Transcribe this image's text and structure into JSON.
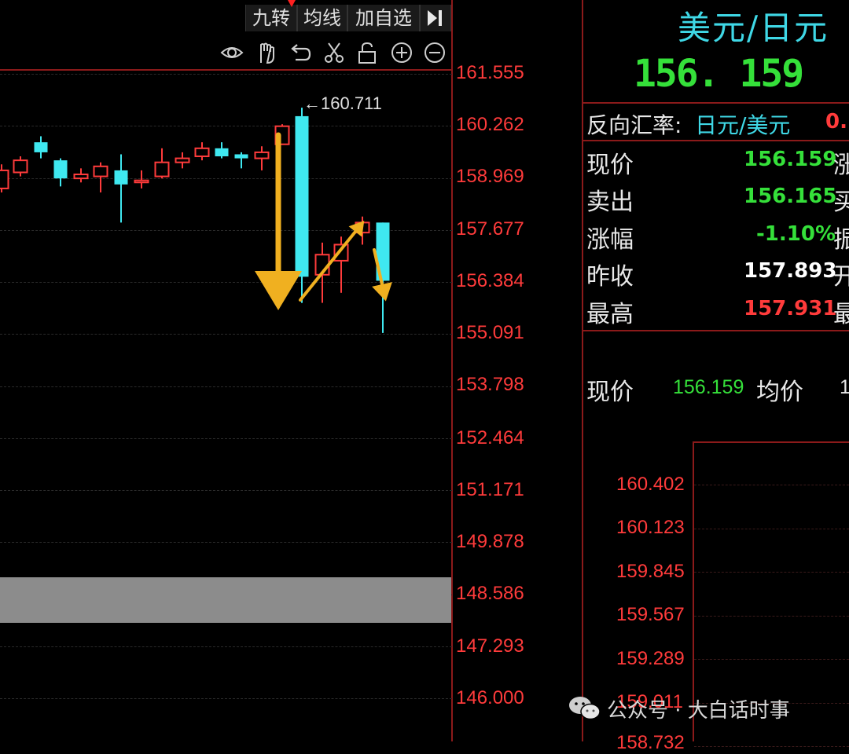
{
  "toolbar": {
    "buttons": [
      "九转",
      "均线",
      "加自选"
    ],
    "collapse_icon": "collapse-right-icon",
    "tools": [
      "eye-icon",
      "hand-icon",
      "undo-icon",
      "scissors-icon",
      "lock-icon",
      "zoom-in-icon",
      "zoom-out-icon"
    ]
  },
  "chart_data": {
    "type": "candlestick",
    "y_axis_labels": [
      "161.555",
      "160.262",
      "158.969",
      "157.677",
      "156.384",
      "155.091",
      "153.798",
      "152.464",
      "151.171",
      "149.878",
      "148.586",
      "147.293",
      "146.000"
    ],
    "ylim": [
      146.0,
      161.555
    ],
    "high_annotation": "160.711",
    "candles": [
      {
        "open": 158.7,
        "close": 159.15,
        "high": 159.3,
        "low": 158.6,
        "dir": "up"
      },
      {
        "open": 159.1,
        "close": 159.4,
        "high": 159.5,
        "low": 159.0,
        "dir": "up"
      },
      {
        "open": 159.6,
        "close": 159.85,
        "high": 160.0,
        "low": 159.45,
        "dir": "down"
      },
      {
        "open": 159.4,
        "close": 158.95,
        "high": 159.45,
        "low": 158.75,
        "dir": "down"
      },
      {
        "open": 158.95,
        "close": 159.05,
        "high": 159.2,
        "low": 158.85,
        "dir": "up"
      },
      {
        "open": 159.0,
        "close": 159.25,
        "high": 159.35,
        "low": 158.6,
        "dir": "up"
      },
      {
        "open": 159.15,
        "close": 158.8,
        "high": 159.55,
        "low": 157.85,
        "dir": "down"
      },
      {
        "open": 158.85,
        "close": 158.9,
        "high": 159.15,
        "low": 158.7,
        "dir": "up"
      },
      {
        "open": 159.0,
        "close": 159.35,
        "high": 159.7,
        "low": 158.95,
        "dir": "up"
      },
      {
        "open": 159.35,
        "close": 159.45,
        "high": 159.6,
        "low": 159.2,
        "dir": "up"
      },
      {
        "open": 159.5,
        "close": 159.7,
        "high": 159.85,
        "low": 159.4,
        "dir": "up"
      },
      {
        "open": 159.7,
        "close": 159.5,
        "high": 159.85,
        "low": 159.45,
        "dir": "down"
      },
      {
        "open": 159.55,
        "close": 159.45,
        "high": 159.6,
        "low": 159.2,
        "dir": "down"
      },
      {
        "open": 159.45,
        "close": 159.6,
        "high": 159.75,
        "low": 159.15,
        "dir": "up"
      },
      {
        "open": 159.8,
        "close": 160.25,
        "high": 160.3,
        "low": 159.8,
        "dir": "up"
      },
      {
        "open": 160.5,
        "close": 156.5,
        "high": 160.711,
        "low": 155.85,
        "dir": "down"
      },
      {
        "open": 156.55,
        "close": 157.05,
        "high": 157.35,
        "low": 155.85,
        "dir": "up"
      },
      {
        "open": 156.9,
        "close": 157.3,
        "high": 157.5,
        "low": 156.1,
        "dir": "up"
      },
      {
        "open": 157.6,
        "close": 157.85,
        "high": 158.0,
        "low": 157.3,
        "dir": "up"
      },
      {
        "open": 157.85,
        "close": 156.4,
        "high": 157.85,
        "low": 155.1,
        "dir": "down"
      }
    ],
    "colors": {
      "up": "#ff3b3b",
      "down": "#3fe8f0",
      "arrow": "#f0b020"
    }
  },
  "panel": {
    "title": "美元/日元",
    "price": "156. 159",
    "reverse_label": "反向汇率:",
    "reverse_pair": "日元/美元",
    "reverse_value": "0.",
    "rows": [
      {
        "label": "现价",
        "value": "156.159",
        "tail": "涨",
        "value_color": "#35e03a"
      },
      {
        "label": "卖出",
        "value": "156.165",
        "tail": "买",
        "value_color": "#35e03a"
      },
      {
        "label": "涨幅",
        "value": "-1.10%",
        "tail": "振",
        "value_color": "#35e03a"
      },
      {
        "label": "昨收",
        "value": "157.893",
        "tail": "开",
        "value_color": "#ffffff"
      },
      {
        "label": "最高",
        "value": "157.931",
        "tail": "最",
        "value_color": "#ff3b3b"
      }
    ],
    "tick_label": "现价",
    "tick_value": "156.159",
    "avg_label": "均价",
    "avg_value": "1",
    "lower_axis": [
      "160.402",
      "160.123",
      "159.845",
      "159.567",
      "159.289",
      "159.011",
      "158.732"
    ]
  },
  "watermark": {
    "icon": "wechat-icon",
    "text": "公众号 · 大白话时事"
  }
}
